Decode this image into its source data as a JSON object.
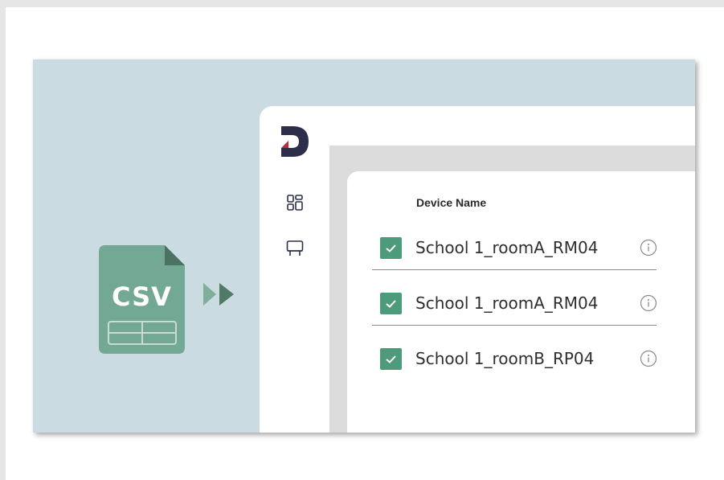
{
  "csv_file": {
    "label": "CSV",
    "icon": "csv-file-icon",
    "color": "#72a894"
  },
  "arrows": {
    "icon": "double-play-arrow-icon",
    "color": "#4e7a66"
  },
  "app": {
    "logo": "app-logo-icon",
    "nav": [
      {
        "name": "dashboard",
        "icon": "grid-icon"
      },
      {
        "name": "devices",
        "icon": "display-icon"
      }
    ],
    "table": {
      "column_header": "Device Name",
      "rows": [
        {
          "name": "School 1_roomA_RM04",
          "checked": true
        },
        {
          "name": "School 1_roomA_RM04",
          "checked": true
        },
        {
          "name": "School 1_roomB_RP04",
          "checked": true
        }
      ]
    }
  },
  "colors": {
    "hero_bg": "#cbdbe2",
    "checkbox": "#4e9b7b",
    "logo_dark": "#2c2e4a",
    "logo_red": "#c4283a"
  }
}
